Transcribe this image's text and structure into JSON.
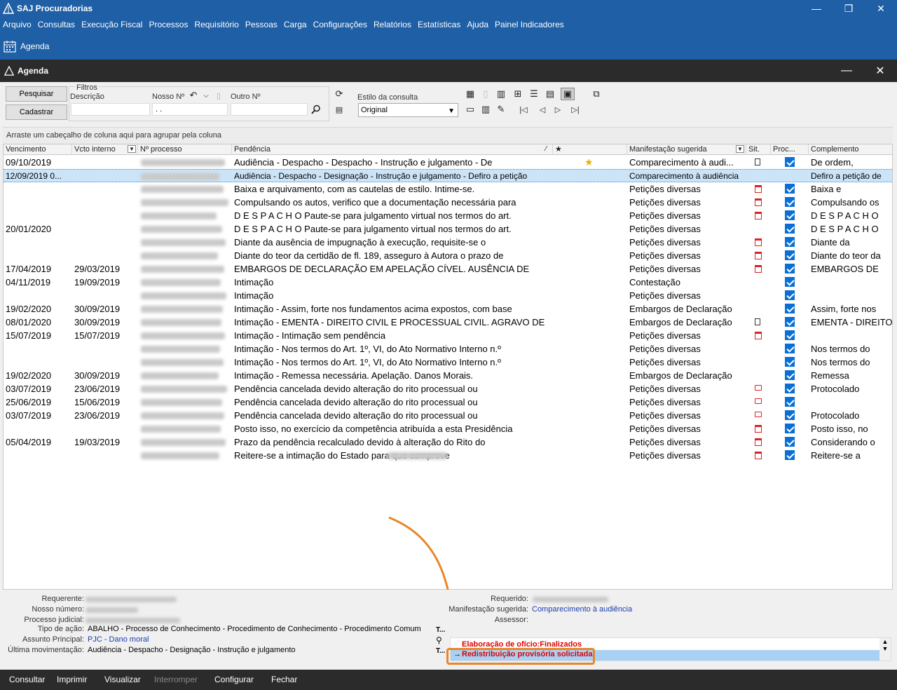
{
  "app": {
    "title": "SAJ Procuradorias",
    "menu": [
      "Arquivo",
      "Consultas",
      "Execução Fiscal",
      "Processos",
      "Requisitório",
      "Pessoas",
      "Carga",
      "Configurações",
      "Relatórios",
      "Estatísticas",
      "Ajuda",
      "Painel Indicadores"
    ],
    "toolbar_agenda": "Agenda"
  },
  "window": {
    "title": "Agenda"
  },
  "filters": {
    "search_label": "Pesquisar",
    "register_label": "Cadastrar",
    "legend": "Filtros",
    "descricao_label": "Descrição",
    "descricao_value": "",
    "nosso_label": "Nosso Nº",
    "nosso_value": ". .",
    "outro_label": "Outro Nº",
    "outro_value": "",
    "estilo_label": "Estilo da consulta",
    "estilo_value": "Original"
  },
  "grid": {
    "group_hint": "Arraste um cabeçalho de coluna aqui para agrupar pela coluna",
    "columns": [
      "Vencimento",
      "Vcto interno",
      "Nº processo",
      "Pendência",
      "★",
      "Manifestação sugerida",
      "Sit.",
      "Proc...",
      "Complemento"
    ],
    "rows": [
      {
        "venc": "09/10/2019",
        "vcto": "",
        "pend": "Audiência - Despacho - Despacho - Instrução e julgamento - De",
        "star": "★",
        "manif": "Comparecimento à audi...",
        "sit": "doc",
        "comp": "De ordem,"
      },
      {
        "venc": "12/09/2019 0...",
        "vcto": "",
        "pend": "Audiência - Despacho - Designação - Instrução e julgamento - Defiro a petição",
        "star": "",
        "manif": "Comparecimento à audiência",
        "sit": "",
        "comp": "Defiro a petição de"
      },
      {
        "venc": "",
        "vcto": "",
        "pend": "Baixa e arquivamento, com as cautelas de estilo. Intime-se.",
        "star": "",
        "manif": "Petições diversas",
        "sit": "cal",
        "comp": "Baixa e"
      },
      {
        "venc": "",
        "vcto": "",
        "pend": "Compulsando os autos, verifico que a documentação necessária para",
        "star": "",
        "manif": "Petições diversas",
        "sit": "cal",
        "comp": "Compulsando os"
      },
      {
        "venc": "",
        "vcto": "",
        "pend": "D E S P A C H O Paute-se para julgamento virtual nos termos do art.",
        "star": "",
        "manif": "Petições diversas",
        "sit": "cal",
        "comp": "D E S P A C H O"
      },
      {
        "venc": "20/01/2020",
        "vcto": "",
        "pend": "D E S P A C H O Paute-se para julgamento virtual nos termos do art.",
        "star": "",
        "manif": "Petições diversas",
        "sit": "",
        "comp": "D E S P A C H O"
      },
      {
        "venc": "",
        "vcto": "",
        "pend": "Diante da ausência de impugnação à execução, requisite-se o",
        "star": "",
        "manif": "Petições diversas",
        "sit": "cal",
        "comp": "Diante da"
      },
      {
        "venc": "",
        "vcto": "",
        "pend": "Diante do teor da certidão de fl. 189, asseguro à Autora o prazo de",
        "star": "",
        "manif": "Petições diversas",
        "sit": "cal",
        "comp": "Diante do teor da"
      },
      {
        "venc": "17/04/2019",
        "vcto": "29/03/2019",
        "pend": "EMBARGOS DE DECLARAÇÃO EM APELAÇÃO CÍVEL. AUSÊNCIA DE",
        "star": "",
        "manif": "Petições diversas",
        "sit": "cal",
        "comp": "EMBARGOS DE"
      },
      {
        "venc": "04/11/2019",
        "vcto": "19/09/2019",
        "pend": "Intimação",
        "star": "",
        "manif": "Contestação",
        "sit": "",
        "comp": ""
      },
      {
        "venc": "",
        "vcto": "",
        "pend": "Intimação",
        "star": "",
        "manif": "Petições diversas",
        "sit": "",
        "comp": ""
      },
      {
        "venc": "19/02/2020",
        "vcto": "30/09/2019",
        "pend": "Intimação - Assim, forte nos fundamentos acima expostos, com base",
        "star": "",
        "manif": "Embargos de Declaração",
        "sit": "",
        "comp": "Assim, forte nos"
      },
      {
        "venc": "08/01/2020",
        "vcto": "30/09/2019",
        "pend": "Intimação - EMENTA - DIREITO CIVIL E PROCESSUAL CIVIL. AGRAVO DE",
        "star": "",
        "manif": "Embargos de Declaração",
        "sit": "doc",
        "comp": "EMENTA - DIREITO"
      },
      {
        "venc": "15/07/2019",
        "vcto": "15/07/2019",
        "pend": "Intimação - Intimação sem pendência",
        "star": "",
        "manif": "Petições diversas",
        "sit": "cal",
        "comp": ""
      },
      {
        "venc": "",
        "vcto": "",
        "pend": "Intimação - Nos termos do Art. 1º, VI, do Ato Normativo Interno n.º",
        "star": "",
        "manif": "Petições diversas",
        "sit": "",
        "comp": "Nos termos do"
      },
      {
        "venc": "",
        "vcto": "",
        "pend": "Intimação - Nos termos do Art. 1º, VI, do Ato Normativo Interno n.º",
        "star": "",
        "manif": "Petições diversas",
        "sit": "",
        "comp": "Nos termos do"
      },
      {
        "venc": "19/02/2020",
        "vcto": "30/09/2019",
        "pend": "Intimação - Remessa necessária. Apelação. Danos Morais.",
        "star": "",
        "manif": "Embargos de Declaração",
        "sit": "",
        "comp": "Remessa"
      },
      {
        "venc": "03/07/2019",
        "vcto": "23/06/2019",
        "pend": "Pendência cancelada devido alteração do rito processual ou",
        "star": "",
        "manif": "Petições diversas",
        "sit": "msg",
        "comp": "Protocolado"
      },
      {
        "venc": "25/06/2019",
        "vcto": "15/06/2019",
        "pend": "Pendência cancelada devido alteração do rito processual ou",
        "star": "",
        "manif": "Petições diversas",
        "sit": "msg",
        "comp": ""
      },
      {
        "venc": "03/07/2019",
        "vcto": "23/06/2019",
        "pend": "Pendência cancelada devido alteração do rito processual ou",
        "star": "",
        "manif": "Petições diversas",
        "sit": "msg",
        "comp": "Protocolado"
      },
      {
        "venc": "",
        "vcto": "",
        "pend": "Posto isso, no exercício da competência atribuída a esta Presidência",
        "star": "",
        "manif": "Petições diversas",
        "sit": "cal",
        "comp": "Posto isso, no"
      },
      {
        "venc": "05/04/2019",
        "vcto": "19/03/2019",
        "pend": "Prazo da pendência recalculado devido à alteração do Rito do",
        "star": "",
        "manif": "Petições diversas",
        "sit": "cal",
        "comp": "Considerando o"
      },
      {
        "venc": "",
        "vcto": "",
        "pend": "Reitere-se a intimação do Estado                    para que comprove",
        "star": "",
        "manif": "Petições diversas",
        "sit": "cal",
        "comp": "Reitere-se a"
      }
    ]
  },
  "details": {
    "requerente_label": "Requerente:",
    "nosso_label": "Nosso número:",
    "processo_label": "Processo judicial:",
    "tipo_label": "Tipo de ação:",
    "tipo_value": "ABALHO - Processo de Conhecimento - Procedimento de Conhecimento - Procedimento Comum",
    "assunto_label": "Assunto Principal:",
    "assunto_value": "PJC - Dano moral",
    "ultima_label": "Última movimentação:",
    "ultima_value": "Audiência - Despacho - Designação - Instrução e julgamento",
    "requerido_label": "Requerido:",
    "manif_label": "Manifestação sugerida:",
    "manif_value": "Comparecimento à audiência",
    "assessor_label": "Assessor:",
    "side_t1": "T...",
    "side_t2": "T...",
    "mov1": "Elaboração de ofício:Finalizados",
    "mov2": "Redistribuição provisória solicitada."
  },
  "bottom": {
    "consultar": "Consultar",
    "imprimir": "Imprimir",
    "visualizar": "Visualizar",
    "interromper": "Interromper",
    "configurar": "Configurar",
    "fechar": "Fechar"
  }
}
